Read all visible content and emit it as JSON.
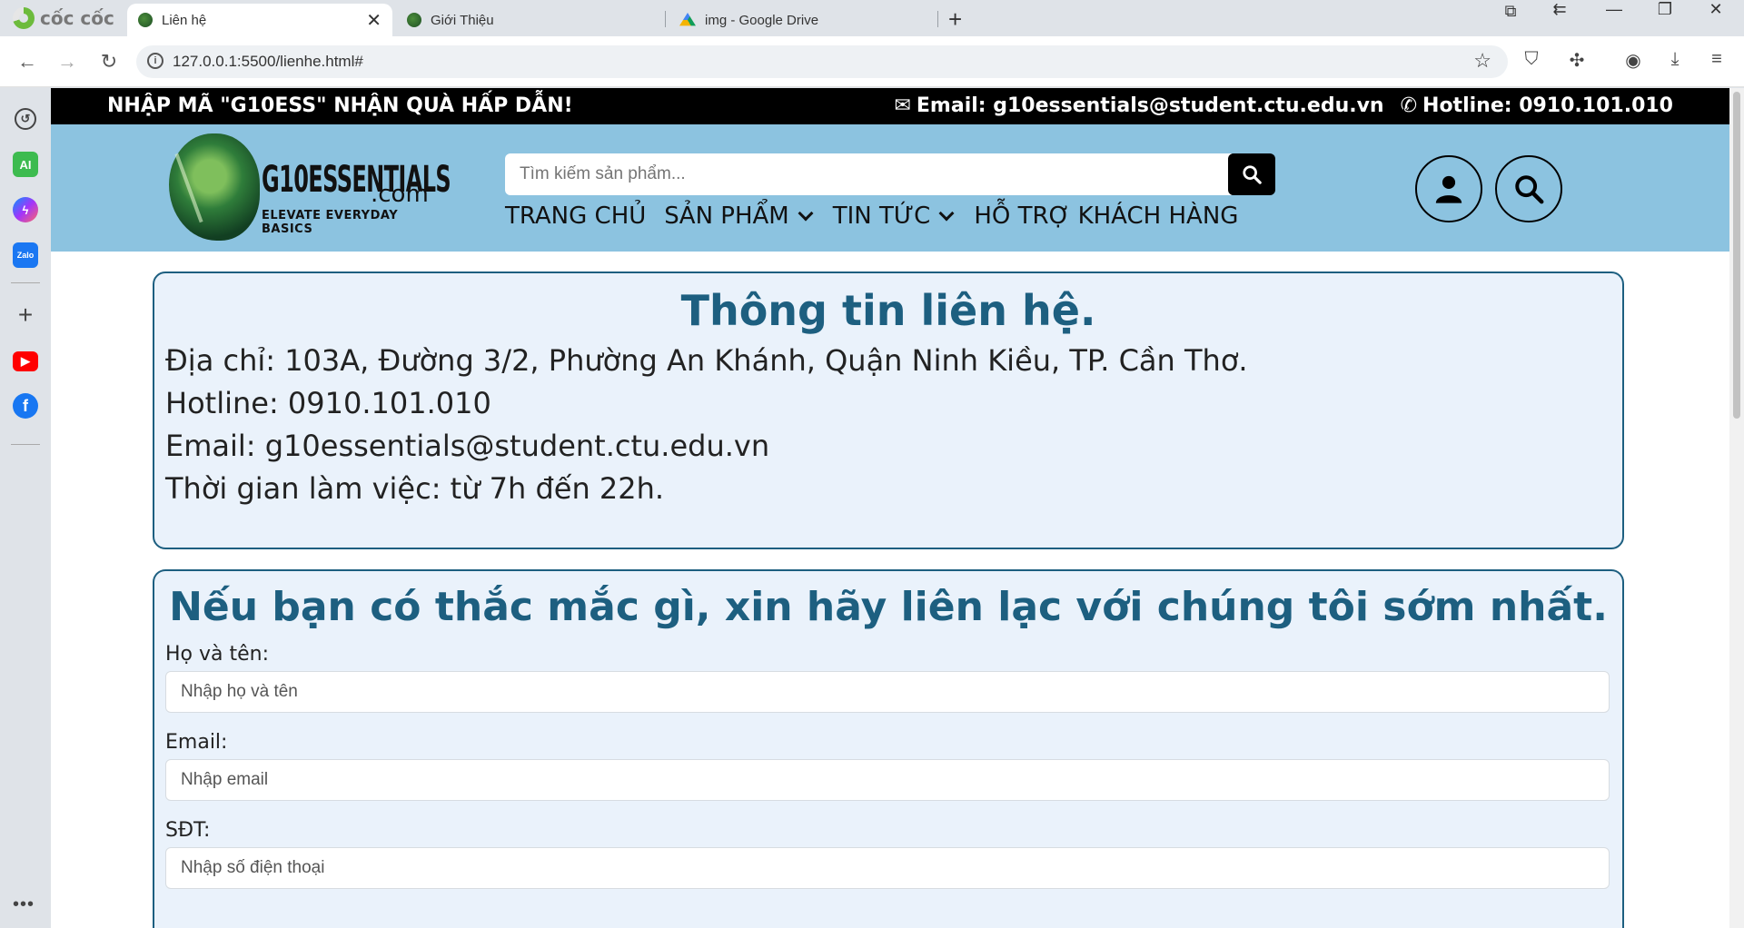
{
  "browser": {
    "brand": "cốc cốc",
    "tabs": [
      {
        "title": "Liên hệ",
        "active": true
      },
      {
        "title": "Giới Thiệu",
        "active": false
      },
      {
        "title": "img - Google Drive",
        "active": false
      }
    ],
    "url": "127.0.0.1:5500/lienhe.html#"
  },
  "promo": {
    "text": "NHẬP MÃ \"G10ESS\" NHẬN QUÀ HẤP DẪN!",
    "email": "Email: g10essentials@student.ctu.edu.vn",
    "hotline": "Hotline: 0910.101.010"
  },
  "logo": {
    "main": "G10ESSENTIALS",
    "suffix": ".com",
    "tagline": "ELEVATE EVERYDAY BASICS"
  },
  "search": {
    "placeholder": "Tìm kiếm sản phẩm..."
  },
  "nav": {
    "items": [
      {
        "label": "TRANG CHỦ"
      },
      {
        "label": "SẢN PHẨM"
      },
      {
        "label": "TIN TỨC"
      },
      {
        "label": "HỖ TRỢ KHÁCH HÀNG"
      }
    ]
  },
  "contact": {
    "title": "Thông tin liên hệ.",
    "address": "Địa chỉ: 103A, Đường 3/2, Phường An Khánh, Quận Ninh Kiều, TP. Cần Thơ.",
    "hotline": "Hotline: 0910.101.010",
    "email": "Email: g10essentials@student.ctu.edu.vn",
    "hours": "Thời gian làm việc: từ 7h đến 22h."
  },
  "form": {
    "title": "Nếu bạn có thắc mắc gì, xin hãy liên lạc với chúng tôi sớm nhất.",
    "name_label": "Họ và tên:",
    "name_placeholder": "Nhập họ và tên",
    "email_label": "Email:",
    "email_placeholder": "Nhập email",
    "phone_label": "SĐT:",
    "phone_placeholder": "Nhập số điện thoại"
  },
  "sidepanel": {
    "ai_label": "AI",
    "zalo_label": "Zalo"
  },
  "colors": {
    "header_bg": "#8cc3e0",
    "title_color": "#1d5f80",
    "card_bg": "#eaf2fb"
  }
}
